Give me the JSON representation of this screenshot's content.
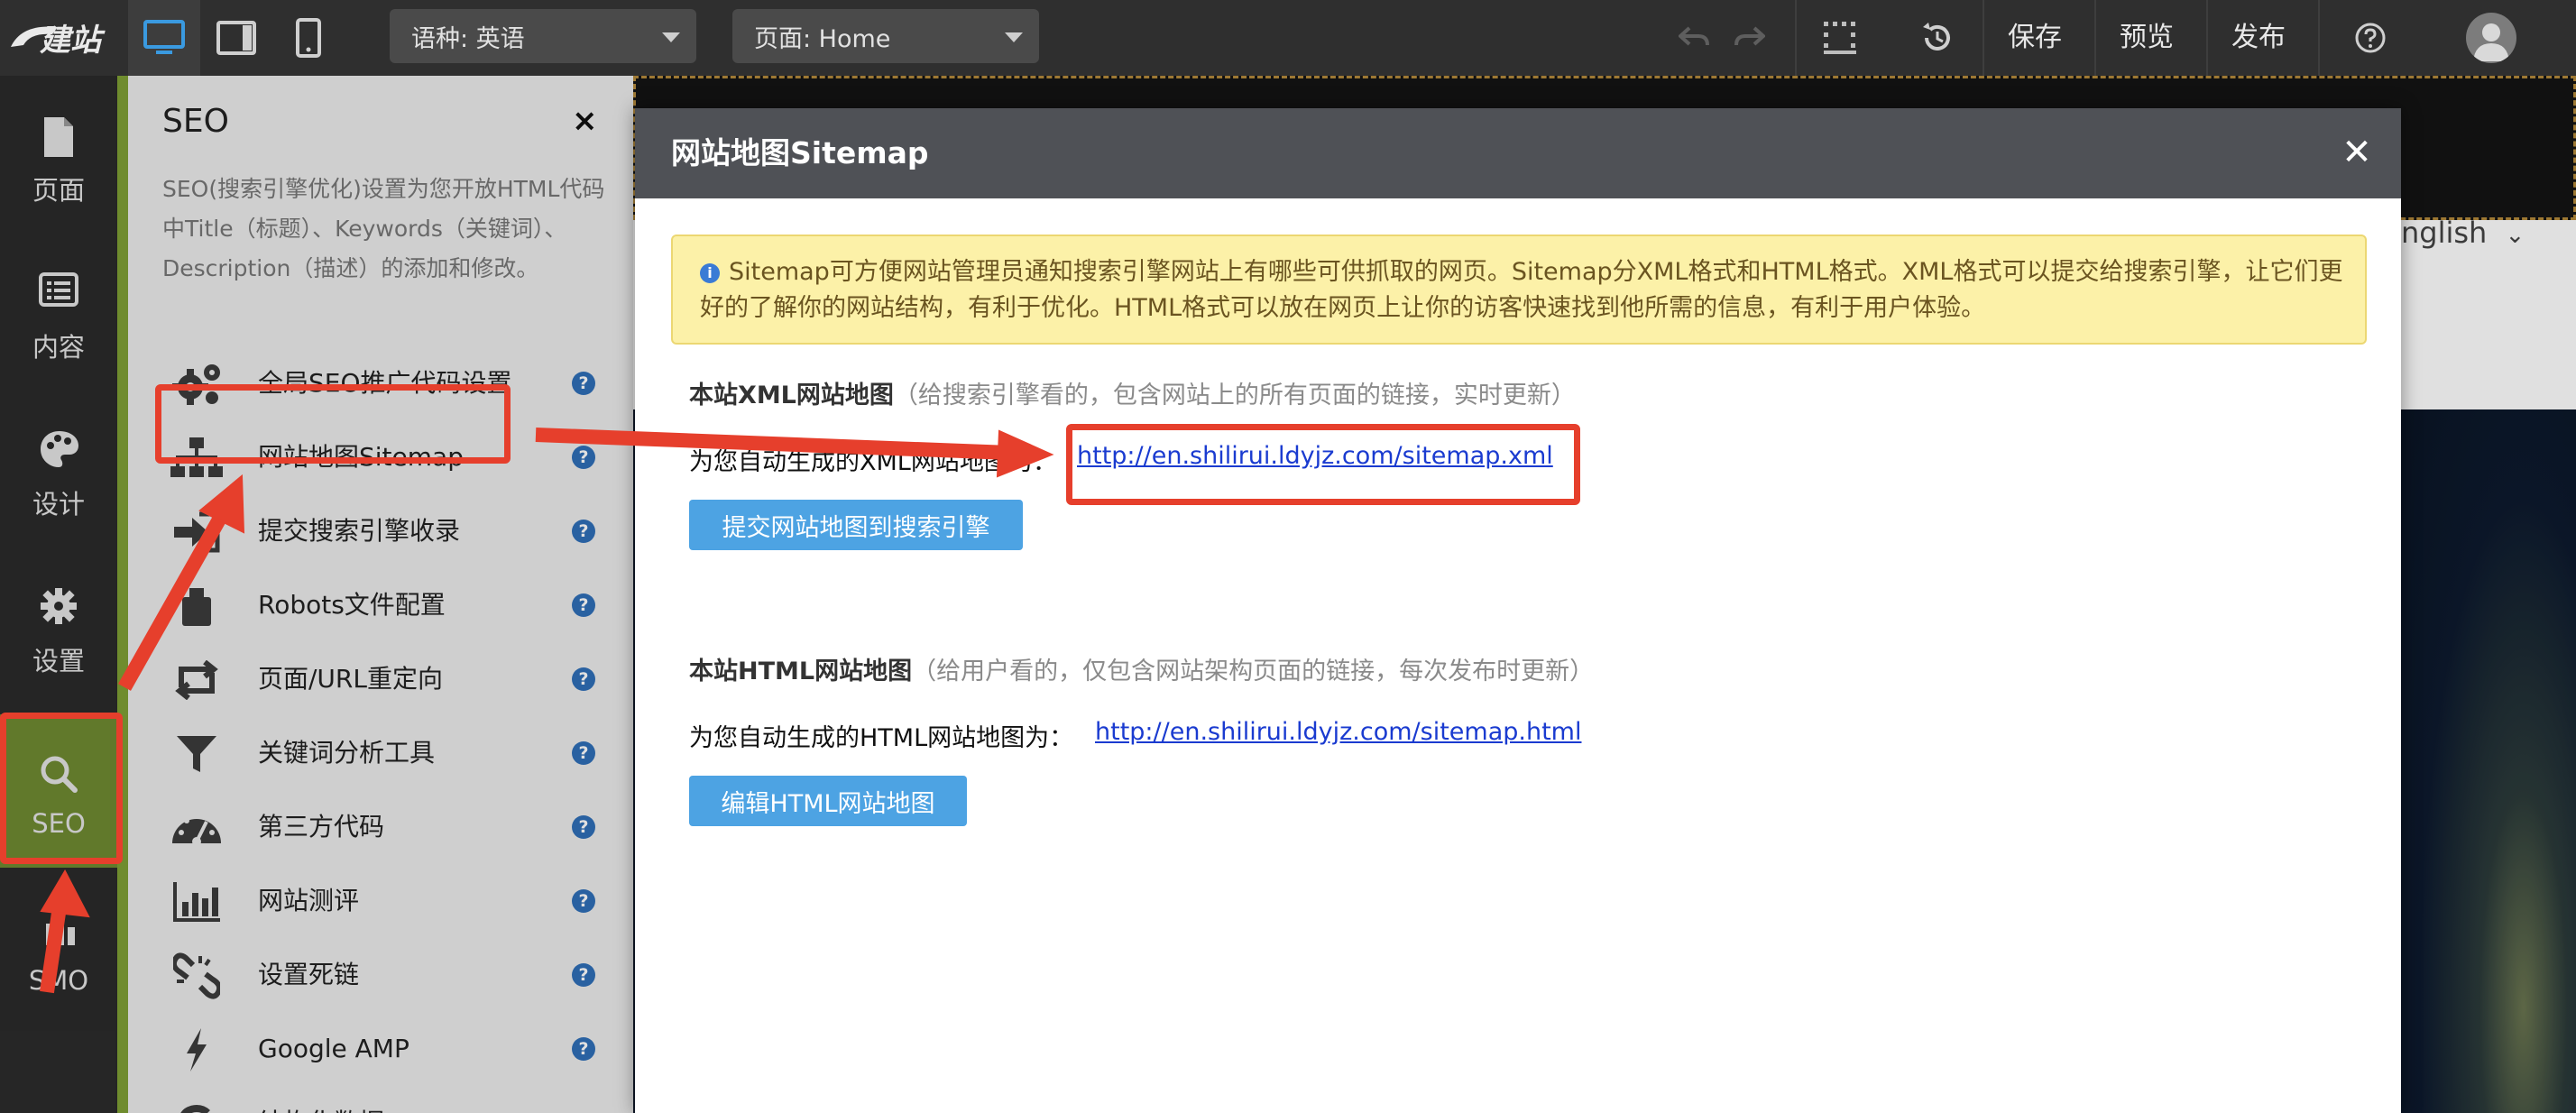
{
  "topbar": {
    "language_select": "语种: 英语",
    "page_select": "页面: Home",
    "save": "保存",
    "preview": "预览",
    "publish": "发布"
  },
  "leftnav": [
    {
      "label": "页面",
      "icon": "page-icon"
    },
    {
      "label": "内容",
      "icon": "list-icon"
    },
    {
      "label": "设计",
      "icon": "palette-icon"
    },
    {
      "label": "设置",
      "icon": "gear-icon"
    },
    {
      "label": "SEO",
      "icon": "search-icon"
    },
    {
      "label": "SMO",
      "icon": "smo-icon"
    }
  ],
  "seo_panel": {
    "title": "SEO",
    "close": "×",
    "description": "SEO(搜索引擎优化)设置为您开放HTML代码中Title（标题）、Keywords（关键词）、Description（描述）的添加和修改。",
    "items": [
      {
        "label": "全局SEO推广代码设置",
        "icon": "gears-icon"
      },
      {
        "label": "网站地图Sitemap",
        "icon": "sitemap-icon"
      },
      {
        "label": "提交搜索引擎收录",
        "icon": "submit-icon"
      },
      {
        "label": "Robots文件配置",
        "icon": "robot-icon"
      },
      {
        "label": "页面/URL重定向",
        "icon": "redirect-icon"
      },
      {
        "label": "关键词分析工具",
        "icon": "filter-icon"
      },
      {
        "label": "第三方代码",
        "icon": "dashboard-icon"
      },
      {
        "label": "网站测评",
        "icon": "bar-chart-icon"
      },
      {
        "label": "设置死链",
        "icon": "broken-link-icon"
      },
      {
        "label": "Google AMP",
        "icon": "bolt-icon"
      },
      {
        "label": "结构化数据",
        "icon": "google-icon"
      }
    ]
  },
  "background_page": {
    "language": "nglish"
  },
  "modal": {
    "title": "网站地图Sitemap",
    "close": "✕",
    "info": "Sitemap可方便网站管理员通知搜索引擎网站上有哪些可供抓取的网页。Sitemap分XML格式和HTML格式。XML格式可以提交给搜索引擎，让它们更好的了解你的网站结构，有利于优化。HTML格式可以放在网页上让你的访客快速找到他所需的信息，有利于用户体验。",
    "xml_section": {
      "title": "本站XML网站地图",
      "subtitle": "（给搜索引擎看的，包含网站上的所有页面的链接，实时更新）",
      "label": "为您自动生成的XML网站地图为：",
      "url": "http://en.shilirui.ldyjz.com/sitemap.xml",
      "button": "提交网站地图到搜索引擎"
    },
    "html_section": {
      "title": "本站HTML网站地图",
      "subtitle": "（给用户看的，仅包含网站架构页面的链接，每次发布时更新）",
      "label": "为您自动生成的HTML网站地图为：",
      "url": "http://en.shilirui.ldyjz.com/sitemap.html",
      "button": "编辑HTML网站地图"
    }
  },
  "colors": {
    "accent_green": "#7fa035",
    "annotation_red": "#e63f2c",
    "button_blue": "#4da3e3",
    "link_blue": "#1a3bd0"
  }
}
